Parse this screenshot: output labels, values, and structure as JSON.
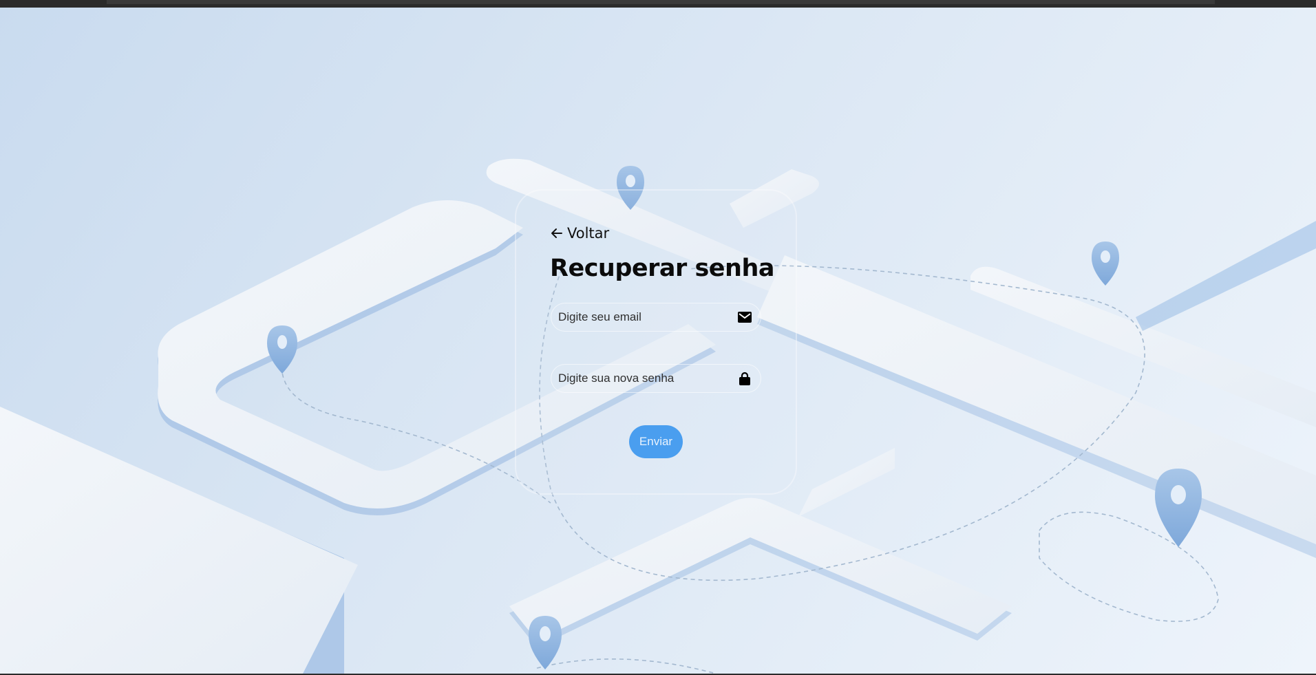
{
  "page": {
    "back_label": "Voltar",
    "title": "Recuperar senha",
    "email_placeholder": "Digite seu email",
    "password_placeholder": "Digite sua nova senha",
    "submit_label": "Enviar"
  },
  "icons": {
    "back": "arrow-left-icon",
    "email": "envelope-icon",
    "password": "lock-icon"
  },
  "colors": {
    "accent": "#4a9eef",
    "background": "#dbe7f4",
    "text": "#0b0b0b"
  }
}
